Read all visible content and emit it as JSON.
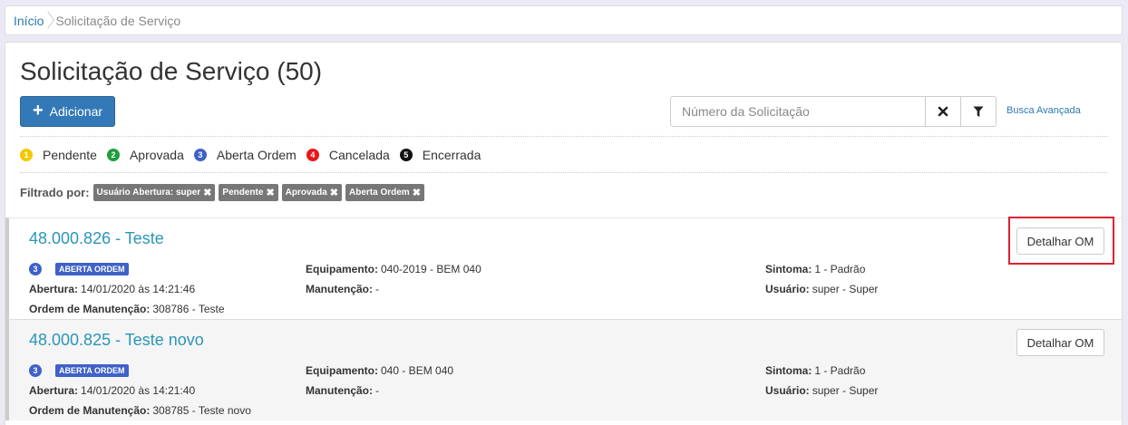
{
  "breadcrumb": {
    "home": "Início",
    "current": "Solicitação de Serviço"
  },
  "page": {
    "title": "Solicitação de Serviço (50)",
    "add_label": "Adicionar",
    "search_placeholder": "Número da Solicitação",
    "advanced_search": "Busca Avançada"
  },
  "legend": [
    {
      "num": "1",
      "label": "Pendente",
      "color": "#f2c800"
    },
    {
      "num": "2",
      "label": "Aprovada",
      "color": "#1e9e3e"
    },
    {
      "num": "3",
      "label": "Aberta Ordem",
      "color": "#3f61c8"
    },
    {
      "num": "4",
      "label": "Cancelada",
      "color": "#e8161b"
    },
    {
      "num": "5",
      "label": "Encerrada",
      "color": "#111111"
    }
  ],
  "filters": {
    "label": "Filtrado por:",
    "chips": [
      "Usuário Abertura: super",
      "Pendente",
      "Aprovada",
      "Aberta Ordem"
    ]
  },
  "labels": {
    "equipamento": "Equipamento:",
    "manutencao": "Manutenção:",
    "sintoma": "Sintoma:",
    "usuario": "Usuário:",
    "abertura": "Abertura:",
    "ordem": "Ordem de Manutenção:",
    "detalhar": "Detalhar OM"
  },
  "requests": [
    {
      "title": "48.000.826 - Teste",
      "status_num": "3",
      "status": "ABERTA ORDEM",
      "equipamento": "040-2019 - BEM 040",
      "manutencao": "-",
      "sintoma": "1 - Padrão",
      "usuario": "super - Super",
      "abertura": "14/01/2020 às 14:21:46",
      "ordem": "308786 - Teste"
    },
    {
      "title": "48.000.825 - Teste novo",
      "status_num": "3",
      "status": "ABERTA ORDEM",
      "equipamento": "040 - BEM 040",
      "manutencao": "-",
      "sintoma": "1 - Padrão",
      "usuario": "super - Super",
      "abertura": "14/01/2020 às 14:21:40",
      "ordem": "308785 - Teste novo"
    }
  ]
}
